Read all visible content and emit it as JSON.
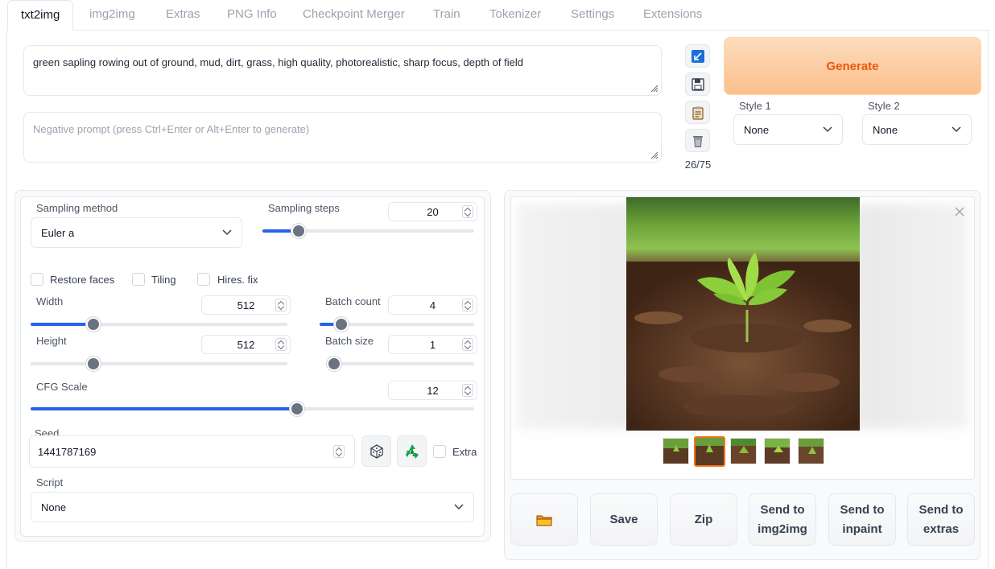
{
  "tabs": [
    "txt2img",
    "img2img",
    "Extras",
    "PNG Info",
    "Checkpoint Merger",
    "Train",
    "Tokenizer",
    "Settings",
    "Extensions"
  ],
  "active_tab": "txt2img",
  "prompt": {
    "value": "green sapling rowing out of ground, mud, dirt, grass, high quality, photorealistic, sharp focus, depth of field",
    "negative_placeholder": "Negative prompt (press Ctrl+Enter or Alt+Enter to generate)"
  },
  "tools": {
    "icons": [
      "arrow-icon",
      "save-icon",
      "clipboard-icon",
      "trash-icon"
    ],
    "token_counter": "26/75"
  },
  "generate_label": "Generate",
  "styles": {
    "style1_label": "Style 1",
    "style1_value": "None",
    "style2_label": "Style 2",
    "style2_value": "None"
  },
  "sampling": {
    "method_label": "Sampling method",
    "method_value": "Euler a",
    "steps_label": "Sampling steps",
    "steps_value": "20",
    "steps_fraction": 0.17
  },
  "checkboxes": {
    "restore_faces": "Restore faces",
    "tiling": "Tiling",
    "hires_fix": "Hires. fix"
  },
  "size": {
    "width_label": "Width",
    "width_value": "512",
    "width_fraction": 0.245,
    "height_label": "Height",
    "height_value": "512",
    "height_fraction": 0.245,
    "batch_count_label": "Batch count",
    "batch_count_value": "4",
    "batch_count_fraction": 0.14,
    "batch_size_label": "Batch size",
    "batch_size_value": "1",
    "batch_size_fraction": 0.0
  },
  "cfg": {
    "label": "CFG Scale",
    "value": "12",
    "fraction": 0.6
  },
  "seed": {
    "label": "Seed",
    "value": "1441787169",
    "extra_label": "Extra"
  },
  "script": {
    "label": "Script",
    "value": "None"
  },
  "actions": {
    "folder_icon": "folder-icon",
    "save": "Save",
    "zip": "Zip",
    "send_img2img_line1": "Send to",
    "send_img2img_line2": "img2img",
    "send_inpaint_line1": "Send to",
    "send_inpaint_line2": "inpaint",
    "send_extras_line1": "Send to",
    "send_extras_line2": "extras"
  },
  "colors": {
    "accent": "#2563eb",
    "generate": "#ea580c"
  }
}
